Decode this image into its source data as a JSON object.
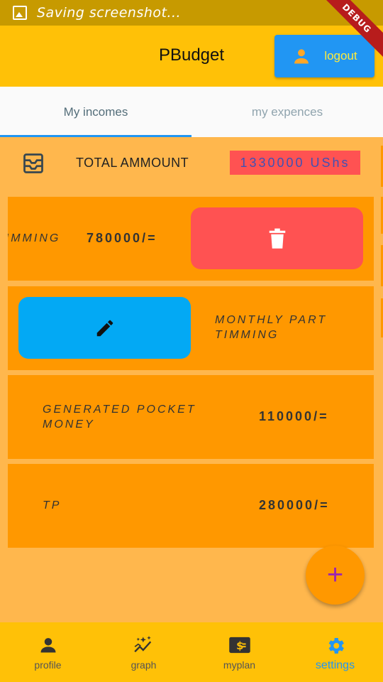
{
  "status_bar": {
    "text": "Saving screenshot..."
  },
  "debug_banner": "DEBUG",
  "appbar": {
    "title": "PBudget",
    "logout_label": "logout"
  },
  "tabs": [
    {
      "label": "My incomes",
      "active": true
    },
    {
      "label": "my expences",
      "active": false
    }
  ],
  "total": {
    "label": "TOTAL AMMOUNT",
    "amount": "1330000 UShs"
  },
  "incomes": [
    {
      "name": "TIMMING",
      "value": "780000/=",
      "action": "delete"
    },
    {
      "name": "MONTHLY PART TIMMING",
      "value": "",
      "action": "edit"
    },
    {
      "name": "GENERATED POCKET MONEY",
      "value": "110000/="
    },
    {
      "name": "TP",
      "value": "280000/="
    }
  ],
  "fab": {
    "label": "+"
  },
  "bottom_nav": [
    {
      "label": "profile",
      "icon": "person-icon",
      "active": false
    },
    {
      "label": "graph",
      "icon": "graph-icon",
      "active": false
    },
    {
      "label": "myplan",
      "icon": "money-icon",
      "active": false
    },
    {
      "label": "settings",
      "icon": "gear-icon",
      "active": true
    }
  ],
  "colors": {
    "appbar": "#FFC107",
    "background": "#FFB74D",
    "card": "#FF9800",
    "delete": "#FF5252",
    "edit": "#03A9F4",
    "accent": "#2196F3"
  }
}
